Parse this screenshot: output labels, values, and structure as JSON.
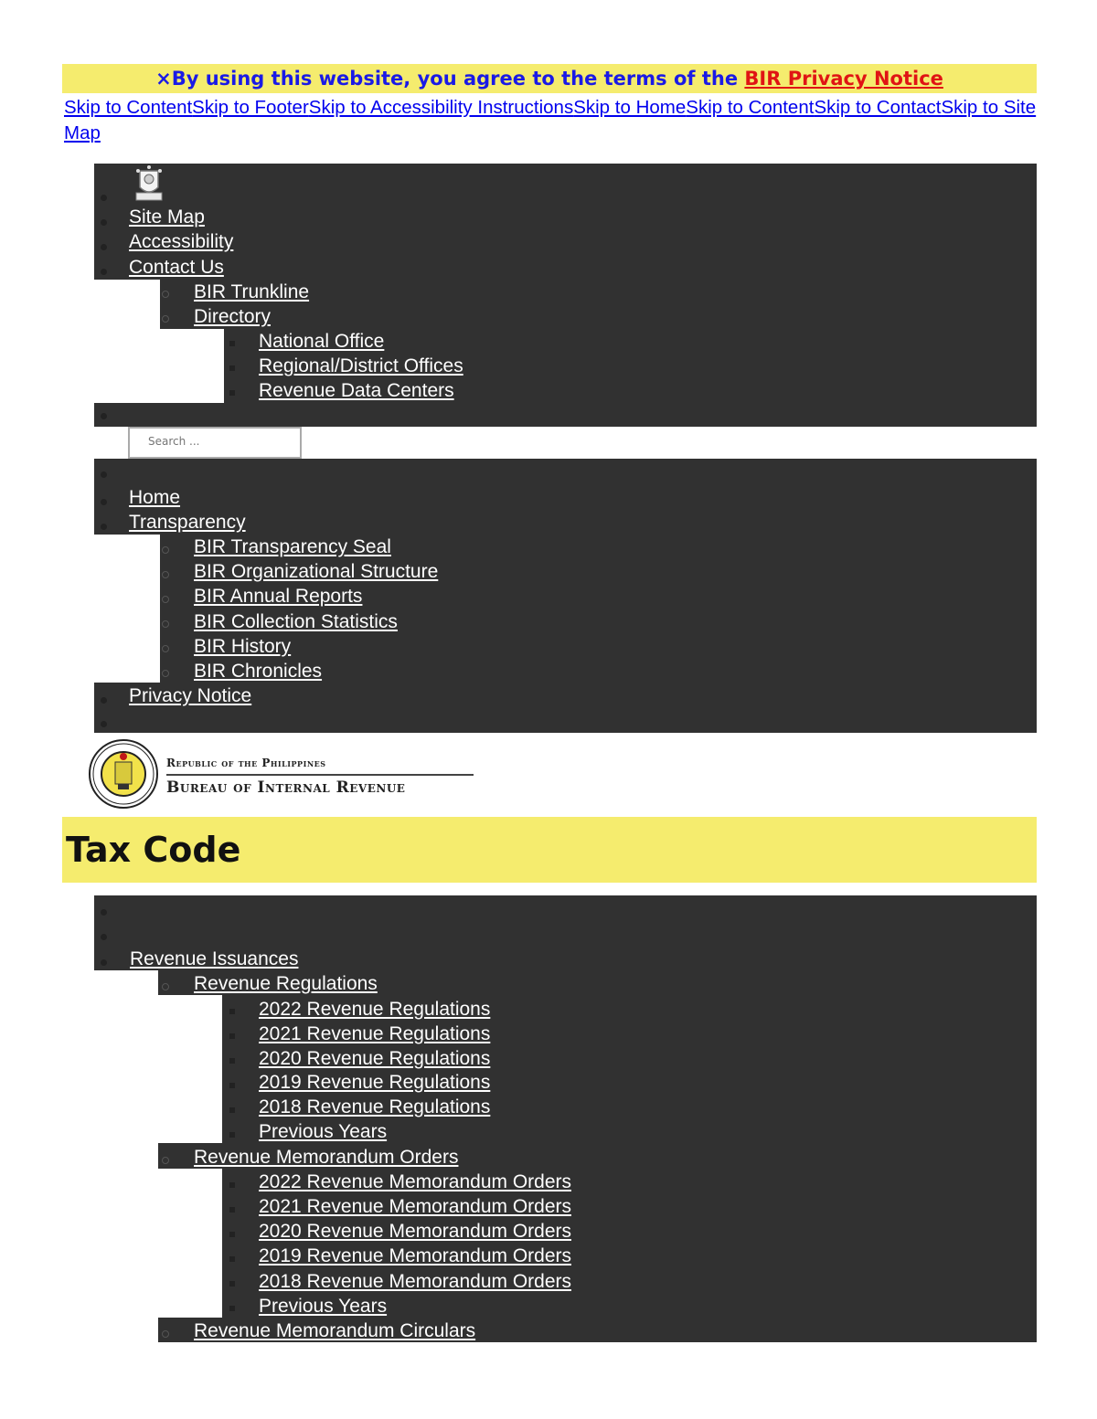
{
  "notice": {
    "close": "×",
    "text": "By using this website, you agree to the terms of the ",
    "link": "BIR Privacy Notice"
  },
  "skip_links": [
    "Skip to Content",
    "Skip to Footer",
    "Skip to Accessibility Instructions",
    "Skip to Home",
    "Skip to Content",
    "Skip to Contact",
    "Skip to Site Map"
  ],
  "top_nav": {
    "items": [
      "Site Map",
      "Accessibility",
      "Contact Us"
    ],
    "contact_sub": [
      "BIR Trunkline",
      "Directory"
    ],
    "directory_sub": [
      "National Office",
      "Regional/District Offices",
      "Revenue Data Centers"
    ]
  },
  "search": {
    "placeholder": "Search ..."
  },
  "main_nav": {
    "items": [
      "Home",
      "Transparency",
      "Privacy Notice"
    ],
    "transparency_sub": [
      "BIR Transparency Seal",
      "BIR Organizational Structure",
      "BIR Annual Reports",
      "BIR Collection Statistics",
      "BIR History",
      "BIR Chronicles"
    ]
  },
  "brand": {
    "line1": "Republic of the Philippines",
    "line2": "Bureau of Internal Revenue"
  },
  "page_title": "Tax Code",
  "issuances_nav": {
    "root": "Revenue Issuances",
    "groups": [
      {
        "label": "Revenue Regulations",
        "items": [
          "2022 Revenue Regulations",
          "2021 Revenue Regulations",
          "2020 Revenue Regulations",
          "2019 Revenue Regulations",
          "2018 Revenue Regulations",
          "Previous Years"
        ]
      },
      {
        "label": "Revenue Memorandum Orders",
        "items": [
          "2022 Revenue Memorandum Orders",
          "2021 Revenue Memorandum Orders",
          "2020 Revenue Memorandum Orders",
          "2019 Revenue Memorandum Orders",
          "2018 Revenue Memorandum Orders",
          "Previous Years"
        ]
      },
      {
        "label": "Revenue Memorandum Circulars",
        "items": []
      }
    ]
  }
}
